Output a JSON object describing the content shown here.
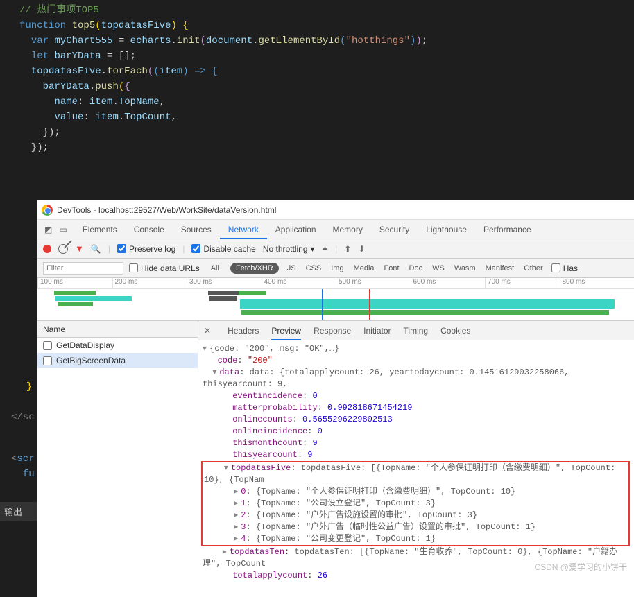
{
  "code": {
    "comment": "// 热门事项TOP5",
    "l1_function": "function",
    "l1_name": "top5",
    "l1_param": "topdatasFive",
    "l2_var": "var",
    "l2_myChart": "myChart555",
    "l2_equals": " = ",
    "l2_echarts": "echarts",
    "l2_init": "init",
    "l2_document": "document",
    "l2_getElementById": "getElementById",
    "l2_str": "\"hotthings\"",
    "l3_let": "let",
    "l3_barYData": "barYData",
    "l3_eq": " = [];",
    "l4_obj": "topdatasFive",
    "l4_forEach": "forEach",
    "l4_item": "item",
    "l4_arrow": " => ",
    "l5_obj": "barYData",
    "l5_push": "push",
    "l6_name": "name",
    "l6_item": "item",
    "l6_TopName": "TopName",
    "l7_value": "value",
    "l7_item": "item",
    "l7_TopCount": "TopCount",
    "l8": "    });",
    "l9": "  });"
  },
  "gutter": {
    "brace": "}",
    "closeScript": "</sc",
    "openScript": "<scr",
    "fu": "  fu",
    "output": "输出"
  },
  "devtools": {
    "title": "DevTools - localhost:29527/Web/WorkSite/dataVersion.html",
    "tabs": [
      "Elements",
      "Console",
      "Sources",
      "Network",
      "Application",
      "Memory",
      "Security",
      "Lighthouse",
      "Performance"
    ],
    "activeTab": 3,
    "preserveLog": "Preserve log",
    "disableCache": "Disable cache",
    "throttling": "No throttling",
    "filterPlaceholder": "Filter",
    "hideDataUrls": "Hide data URLs",
    "pills": [
      "All",
      "Fetch/XHR"
    ],
    "ftypes": [
      "JS",
      "CSS",
      "Img",
      "Media",
      "Font",
      "Doc",
      "WS",
      "Wasm",
      "Manifest",
      "Other"
    ],
    "hasCheck": "Has",
    "ruler": [
      "100 ms",
      "200 ms",
      "300 ms",
      "400 ms",
      "500 ms",
      "600 ms",
      "700 ms",
      "800 ms"
    ],
    "reqHeader": "Name",
    "requests": [
      "GetDataDisplay",
      "GetBigScreenData"
    ],
    "selectedRequest": 1,
    "detailTabs": [
      "Headers",
      "Preview",
      "Response",
      "Initiator",
      "Timing",
      "Cookies"
    ],
    "activeDetailTab": 1
  },
  "preview": {
    "root": "{code: \"200\", msg: \"OK\",…}",
    "codeKey": "code",
    "codeVal": "\"200\"",
    "dataLine": "data: {totalapplycount: 26, yeartodaycount: 0.14516129032258066, thisyearcount: 9,",
    "rows": [
      {
        "k": "eventincidence",
        "v": "0"
      },
      {
        "k": "matterprobability",
        "v": "0.992818671454219"
      },
      {
        "k": "onlinecounts",
        "v": "0.5655296229802513"
      },
      {
        "k": "onlineincidence",
        "v": "0"
      },
      {
        "k": "thismonthcount",
        "v": "9"
      },
      {
        "k": "thisyearcount",
        "v": "9"
      }
    ],
    "topdatasFiveHead": "topdatasFive: [{TopName: \"个人参保证明打印（含缴费明细）\", TopCount: 10}, {TopNam",
    "five": [
      {
        "idx": "0",
        "body": "{TopName: \"个人参保证明打印（含缴费明细）\", TopCount: 10}"
      },
      {
        "idx": "1",
        "body": "{TopName: \"公司设立登记\", TopCount: 3}"
      },
      {
        "idx": "2",
        "body": "{TopName: \"户外广告设施设置的审批\", TopCount: 3}"
      },
      {
        "idx": "3",
        "body": "{TopName: \"户外广告（临时性公益广告）设置的审批\", TopCount: 1}"
      },
      {
        "idx": "4",
        "body": "{TopName: \"公司变更登记\", TopCount: 1}"
      }
    ],
    "topdatasTen": "topdatasTen: [{TopName: \"生育收养\", TopCount: 0}, {TopName: \"户籍办理\", TopCount",
    "totalapply": {
      "k": "totalapplycount",
      "v": "26"
    }
  },
  "watermark": "CSDN @爱学习的小饼干"
}
